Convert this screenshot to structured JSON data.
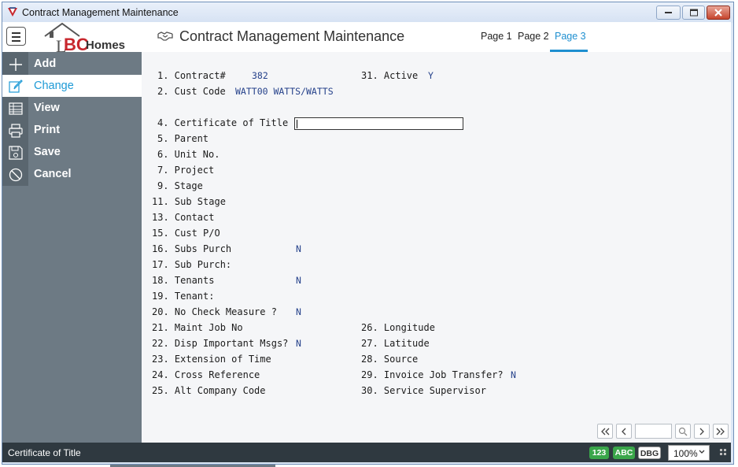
{
  "window": {
    "title": "Contract Management Maintenance"
  },
  "header": {
    "logo": {
      "l": "L",
      "bc": "BC",
      "homes": "Homes"
    },
    "title": "Contract Management Maintenance",
    "tabs": [
      {
        "label": "Page 1"
      },
      {
        "label": "Page 2"
      },
      {
        "label": "Page 3",
        "active": true
      }
    ]
  },
  "sidebar": {
    "items": [
      {
        "label": "Add",
        "icon": "plus-icon"
      },
      {
        "label": "Change",
        "icon": "edit-icon",
        "active": true
      },
      {
        "label": "View",
        "icon": "table-icon"
      },
      {
        "label": "Print",
        "icon": "printer-icon"
      },
      {
        "label": "Save",
        "icon": "save-icon"
      },
      {
        "label": "Cancel",
        "icon": "cancel-icon"
      }
    ]
  },
  "form": {
    "f1": {
      "label": "1. Contract#",
      "value": "382"
    },
    "f31": {
      "label": "31. Active",
      "value": "Y"
    },
    "f2": {
      "label": "2. Cust Code",
      "value": "WATT00 WATTS/WATTS"
    },
    "f4": {
      "label": "4. Certificate of Title",
      "value": ""
    },
    "f5": {
      "label": "5. Parent"
    },
    "f6": {
      "label": "6. Unit No."
    },
    "f7": {
      "label": "7. Project"
    },
    "f9": {
      "label": "9. Stage"
    },
    "f11": {
      "label": "11. Sub Stage"
    },
    "f13": {
      "label": "13. Contact"
    },
    "f15": {
      "label": "15. Cust P/O"
    },
    "f16": {
      "label": "16. Subs Purch",
      "value": "N"
    },
    "f17": {
      "label": "17. Sub Purch:"
    },
    "f18": {
      "label": "18. Tenants",
      "value": "N"
    },
    "f19": {
      "label": "19. Tenant:"
    },
    "f20": {
      "label": "20. No Check Measure ?",
      "value": "N"
    },
    "f21": {
      "label": "21. Maint Job No"
    },
    "f26": {
      "label": "26. Longitude"
    },
    "f22": {
      "label": "22. Disp Important Msgs?",
      "value": "N"
    },
    "f27": {
      "label": "27. Latitude"
    },
    "f23": {
      "label": "23. Extension of Time"
    },
    "f28": {
      "label": "28. Source"
    },
    "f24": {
      "label": "24. Cross Reference"
    },
    "f29": {
      "label": "29. Invoice Job Transfer?",
      "value": "N"
    },
    "f25": {
      "label": "25. Alt Company Code"
    },
    "f30": {
      "label": "30. Service Supervisor"
    }
  },
  "pager": {
    "page_value": ""
  },
  "status": {
    "message": "Certificate of Title",
    "badges": {
      "num": "123",
      "abc": "ABC",
      "dbg": "DBG"
    },
    "zoom": "100%"
  },
  "colors": {
    "accent": "#1e9ad6",
    "sidebar": "#6d7a84",
    "statusbar": "#2f3940",
    "badge_green": "#3aa64a"
  }
}
